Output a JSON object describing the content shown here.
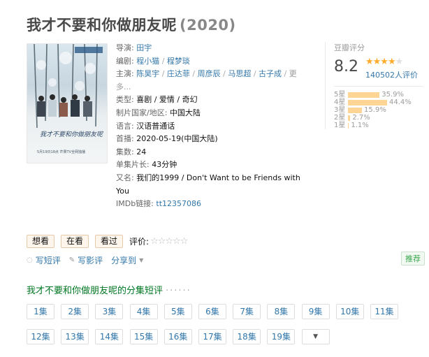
{
  "title": {
    "name": "我才不要和你做朋友呢",
    "year": "(2020)"
  },
  "poster": {
    "tag": "豆瓣独播",
    "overlay_title": "我才不要和你做朋友呢",
    "caption": "5月19日18点 芒果TV全网独播"
  },
  "info": {
    "director_label": "导演:",
    "directors": [
      "田宇"
    ],
    "writer_label": "编剧:",
    "writers": [
      "程小猫",
      "程梦琰"
    ],
    "cast_label": "主演:",
    "cast": [
      "陈昊宇",
      "庄达菲",
      "周彦辰",
      "马思超",
      "古子成"
    ],
    "cast_more": "更多...",
    "genre_label": "类型:",
    "genres": "喜剧 / 爱情 / 奇幻",
    "region_label": "制片国家/地区:",
    "region": "中国大陆",
    "language_label": "语言:",
    "language": "汉语普通话",
    "premiere_label": "首播:",
    "premiere": "2020-05-19(中国大陆)",
    "episodes_label": "集数:",
    "episodes": "24",
    "runtime_label": "单集片长:",
    "runtime": "43分钟",
    "aka_label": "又名:",
    "aka": "我们的1999 / Don't Want to be Friends with You",
    "imdb_label": "IMDb链接:",
    "imdb": "tt12357086"
  },
  "rating": {
    "label": "豆瓣评分",
    "score": "8.2",
    "stars_filled": 4,
    "stars_total": 5,
    "votes": "140502人评价",
    "distribution": [
      {
        "label": "5星",
        "percent": "35.9%",
        "value": 35.9
      },
      {
        "label": "4星",
        "percent": "44.4%",
        "value": 44.4
      },
      {
        "label": "3星",
        "percent": "15.9%",
        "value": 15.9
      },
      {
        "label": "2星",
        "percent": "2.7%",
        "value": 2.7
      },
      {
        "label": "1星",
        "percent": "1.1%",
        "value": 1.1
      }
    ]
  },
  "actions": {
    "want": "想看",
    "doing": "在看",
    "done": "看过",
    "rate_label": "评价:"
  },
  "links": {
    "short_review": "写短评",
    "review": "写影评",
    "share": "分享到",
    "recommend": "推荐"
  },
  "episode_section": {
    "title": "我才不要和你做朋友呢的分集短评",
    "dots": "······"
  },
  "episode_buttons": [
    "1集",
    "2集",
    "3集",
    "4集",
    "5集",
    "6集",
    "7集",
    "8集",
    "9集",
    "10集",
    "11集",
    "12集",
    "13集",
    "14集",
    "15集",
    "16集",
    "17集",
    "18集",
    "19集"
  ],
  "colors": {
    "link": "#3377aa",
    "star": "#ffac2d",
    "section": "#007722",
    "action_bg": "#fef6ed"
  }
}
